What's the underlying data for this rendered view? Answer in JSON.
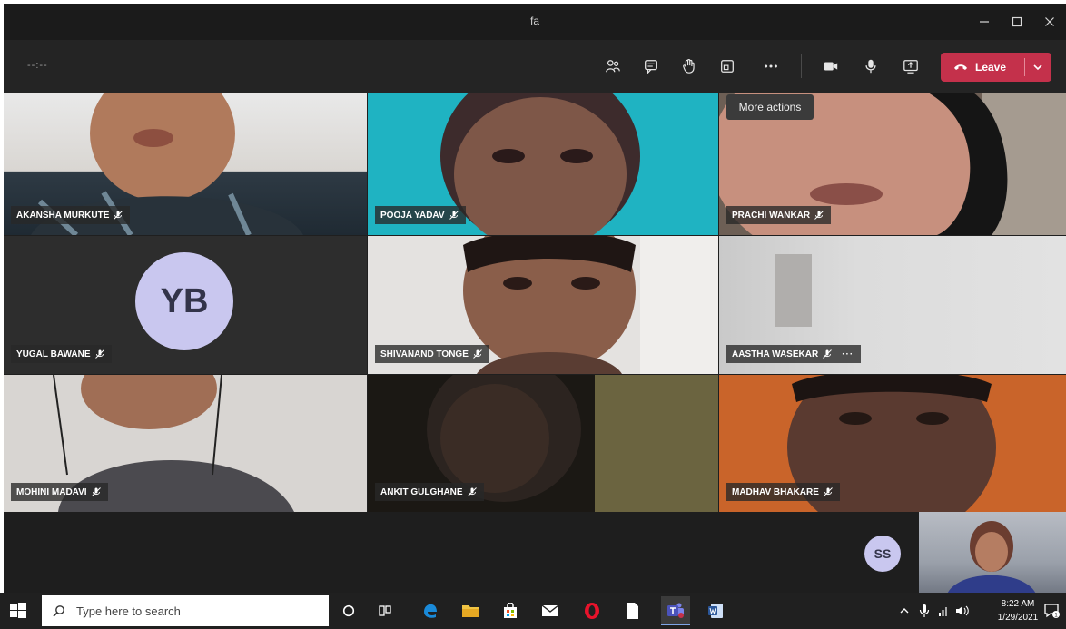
{
  "window": {
    "title": "fa"
  },
  "toolbar": {
    "timer": "--:--",
    "leave_label": "Leave",
    "tooltip": "More actions",
    "buttons": [
      "people-icon",
      "chat-icon",
      "raise-hand-icon",
      "rooms-icon",
      "more-actions-icon",
      "camera-icon",
      "mic-icon",
      "share-screen-icon"
    ]
  },
  "participants": [
    {
      "name": "AKANSHA MURKUTE"
    },
    {
      "name": "POOJA YADAV"
    },
    {
      "name": "PRACHI WANKAR"
    },
    {
      "name": "YUGAL BAWANE",
      "initials": "YB"
    },
    {
      "name": "SHIVANAND TONGE"
    },
    {
      "name": "AASTHA WASEKAR",
      "more": "···"
    },
    {
      "name": "MOHINI MADAVI"
    },
    {
      "name": "ANKIT GULGHANE"
    },
    {
      "name": "MADHAV BHAKARE"
    }
  ],
  "strip": {
    "initials": "SS"
  },
  "taskbar": {
    "search_placeholder": "Type here to search",
    "time": "8:22 AM",
    "date": "1/29/2021",
    "notification_count": "1"
  }
}
